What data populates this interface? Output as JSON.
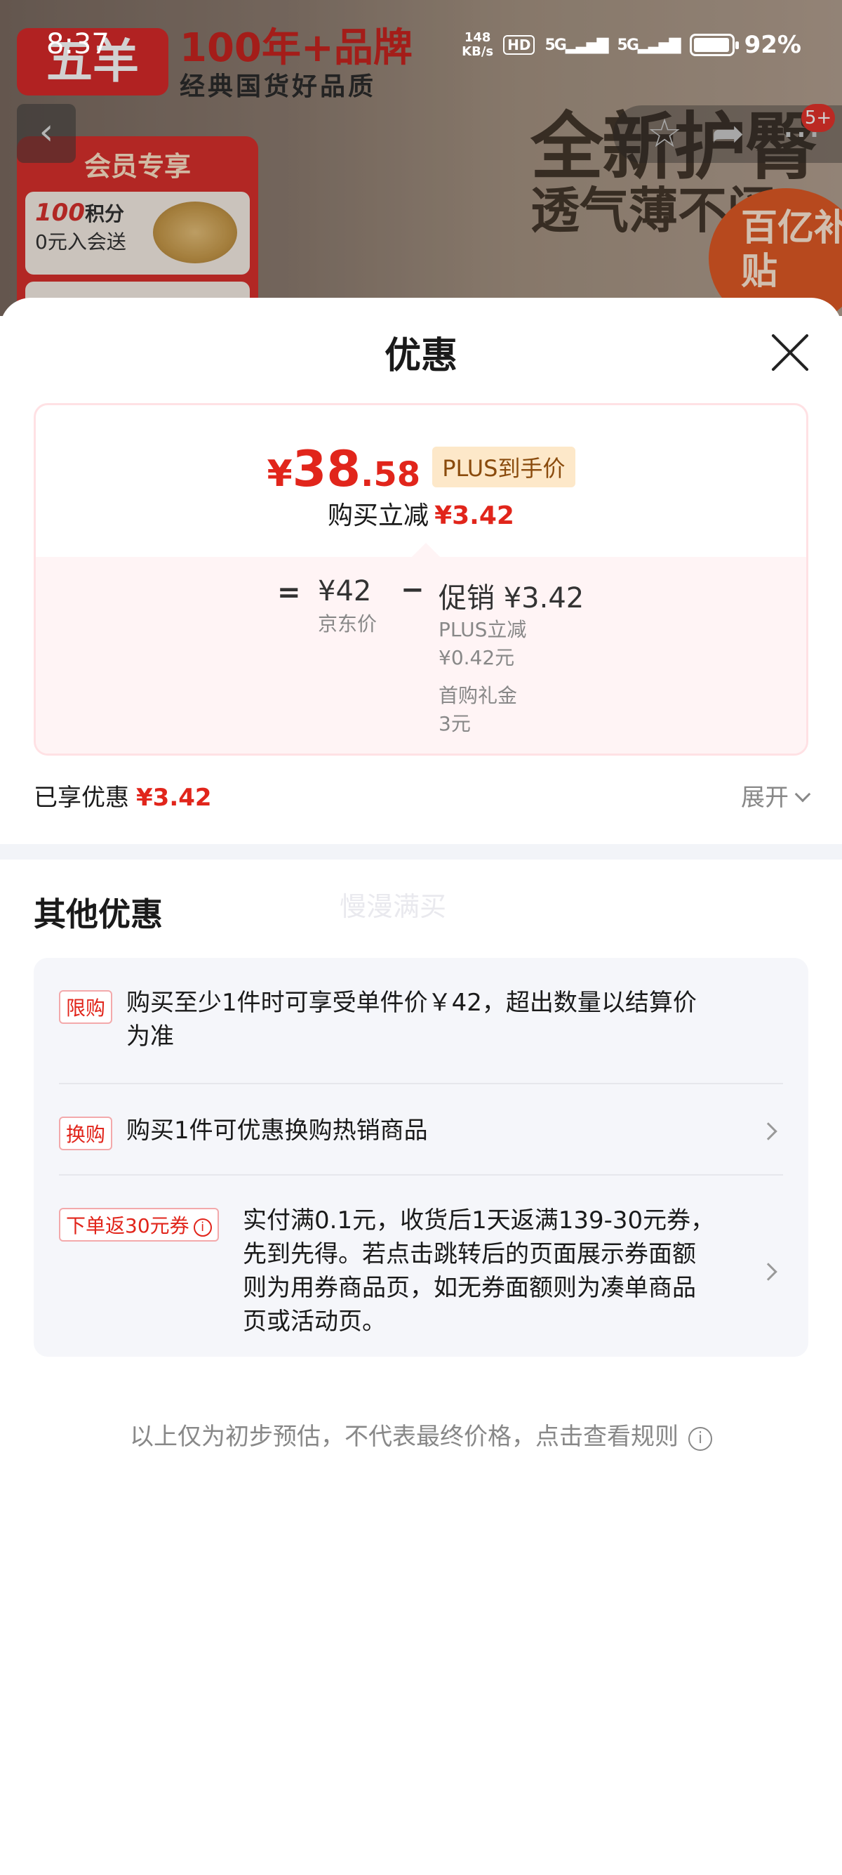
{
  "status_bar": {
    "time": "8:37",
    "speed_value": "148",
    "speed_unit": "KB/s",
    "hd": "HD",
    "network1": "5G",
    "network2": "5G",
    "battery": "92%"
  },
  "background": {
    "brand": "五羊",
    "slogan": "100年+品牌",
    "slogan_sub": "经典国货好品质",
    "member_title": "会员专享",
    "member_points": "100",
    "member_points_unit": "积分",
    "member_join": "0元入会送",
    "headline": "全新护臀",
    "subline": "透气薄不闷",
    "badge": "5+",
    "subsidy": "百亿补贴"
  },
  "sheet": {
    "title": "优惠",
    "price": {
      "currency": "¥",
      "integer": "38",
      "decimal": ".58",
      "tag": "PLUS到手价",
      "reduce_label": "购买立减",
      "reduce_value": "¥3.42"
    },
    "breakdown": {
      "equals": "=",
      "jd_value": "¥42",
      "jd_label": "京东价",
      "minus": "−",
      "promo_value": "促销 ¥3.42",
      "plus_label": "PLUS立减",
      "plus_value": "¥0.42元",
      "gift_label": "首购礼金",
      "gift_value": "3元"
    },
    "enjoyed_label": "已享优惠",
    "enjoyed_value": "¥3.42",
    "expand_label": "展开",
    "other_title": "其他优惠",
    "watermark": "慢漫满买",
    "offers": [
      {
        "tag": "限购",
        "text_line1": "购买至少1件时可享受单件价￥42，超出数量以结算价",
        "text_line2": "为准"
      },
      {
        "tag": "换购",
        "text_line1": "购买1件可优惠换购热销商品"
      },
      {
        "tag": "下单返30元券",
        "text_line1": "实付满0.1元，收货后1天返满139-30元券，",
        "text_line2": "先到先得。若点击跳转后的页面展示券面额",
        "text_line3": "则为用券商品页，如无券面额则为凑单商品",
        "text_line4": "页或活动页。"
      }
    ],
    "footnote": "以上仅为初步预估，不代表最终价格，点击查看规则"
  }
}
